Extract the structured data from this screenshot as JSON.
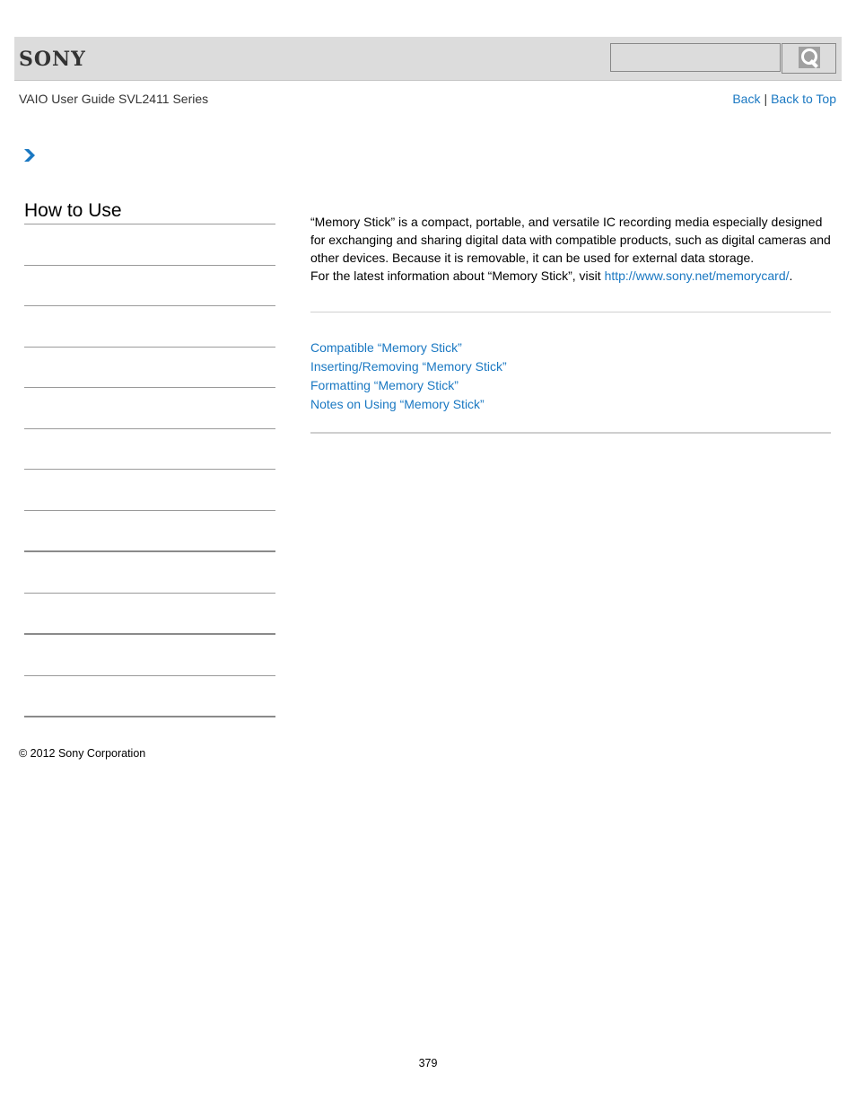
{
  "header": {
    "logo": "SONY",
    "search": {
      "placeholder": "",
      "value": "",
      "button_icon": "search-icon"
    }
  },
  "subheader": {
    "guide_title": "VAIO User Guide SVL2411 Series",
    "nav": {
      "back": "Back",
      "separator": "|",
      "back_to_top": "Back to Top"
    }
  },
  "breadcrumb": {
    "icon": "chevron-right-icon",
    "color": "#1a78c2"
  },
  "sidebar": {
    "title": "How to Use",
    "rule_count": 13
  },
  "main": {
    "intro": {
      "line1": "“Memory Stick” is a compact, portable, and versatile IC recording media especially designed for exchanging and sharing digital data with compatible products, such as digital cameras and other devices. Because it is removable, it can be used for external data storage.",
      "line2_prefix": "For the latest information about “Memory Stick”, visit ",
      "link": "http://www.sony.net/memorycard/",
      "line2_suffix": "."
    },
    "related_links": [
      "Compatible “Memory Stick”",
      "Inserting/Removing “Memory Stick”",
      "Formatting “Memory Stick”",
      "Notes on Using “Memory Stick”"
    ]
  },
  "footer": {
    "copyright": "© 2012 Sony Corporation",
    "page_number": "379"
  },
  "colors": {
    "link": "#1a78c2",
    "header_bg": "#dcdcdc"
  }
}
